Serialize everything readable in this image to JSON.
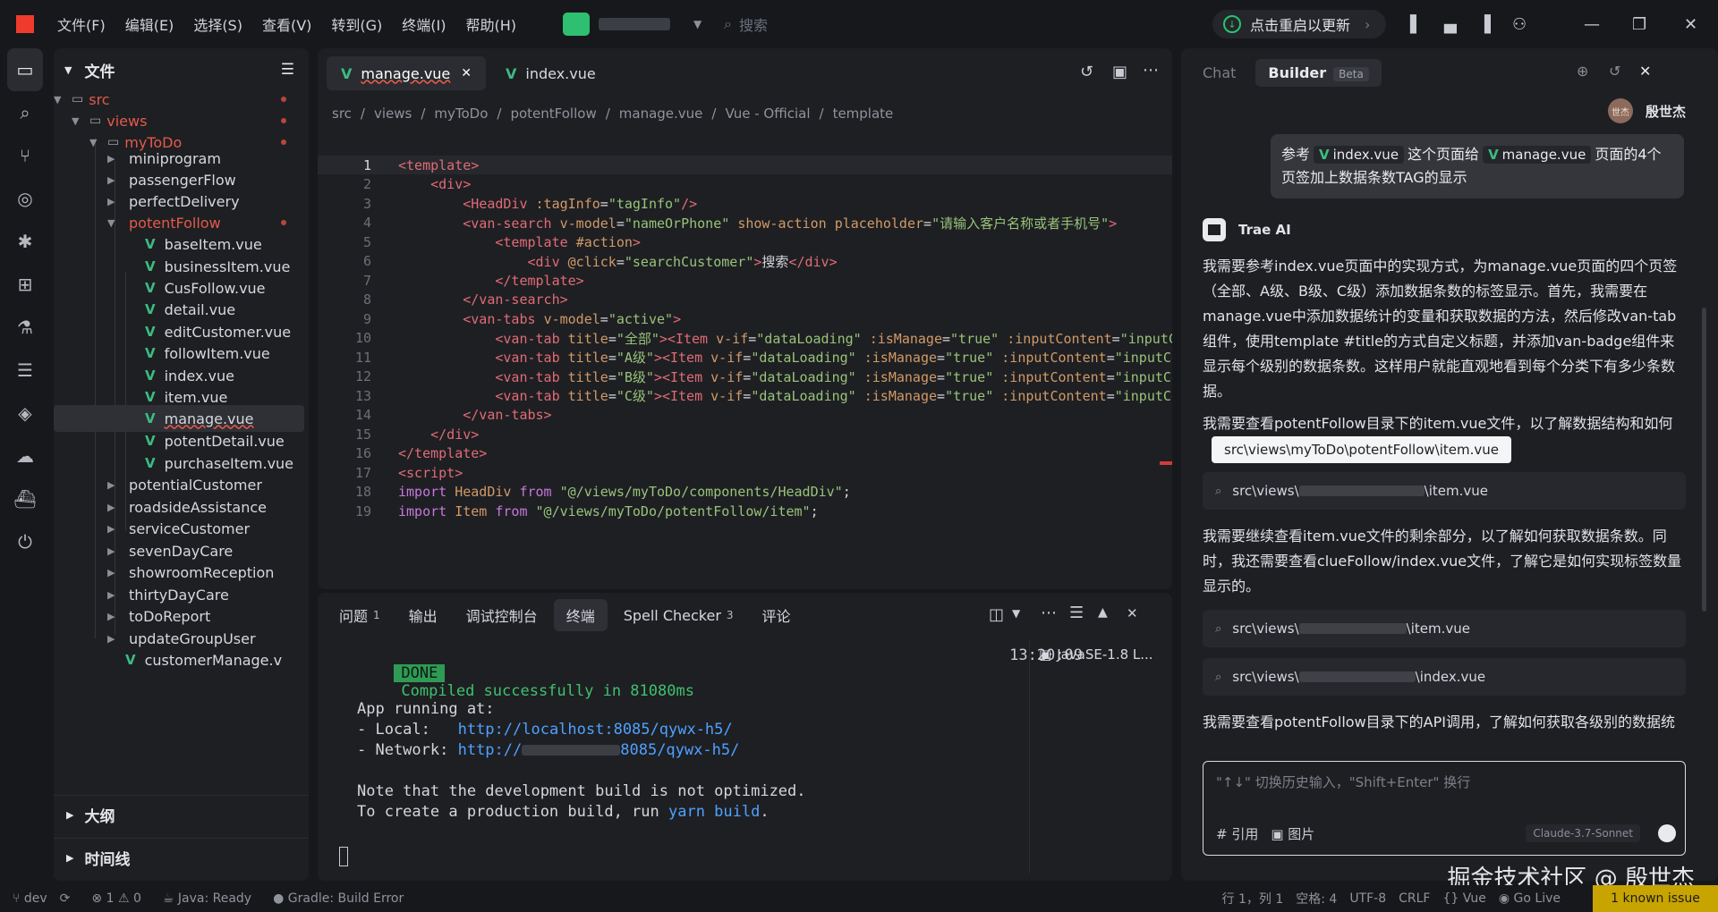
{
  "titlebar": {
    "menus": [
      "文件(F)",
      "编辑(E)",
      "选择(S)",
      "查看(V)",
      "转到(G)",
      "终端(I)",
      "帮助(H)"
    ],
    "search_placeholder": "搜索",
    "update_label": "点击重启以更新"
  },
  "sidebar": {
    "title": "文件",
    "tree": [
      {
        "label": "src",
        "type": "folder",
        "error": true
      },
      {
        "label": "views",
        "type": "folder",
        "error": true
      },
      {
        "label": "myToDo",
        "type": "folder",
        "error": true
      },
      {
        "label": "miniprogram",
        "type": "folder"
      },
      {
        "label": "passengerFlow",
        "type": "folder"
      },
      {
        "label": "perfectDelivery",
        "type": "folder"
      },
      {
        "label": "potentFollow",
        "type": "folder",
        "error": true
      },
      {
        "label": "baseItem.vue",
        "type": "vue"
      },
      {
        "label": "businessItem.vue",
        "type": "vue"
      },
      {
        "label": "CusFollow.vue",
        "type": "vue"
      },
      {
        "label": "detail.vue",
        "type": "vue"
      },
      {
        "label": "editCustomer.vue",
        "type": "vue"
      },
      {
        "label": "followItem.vue",
        "type": "vue"
      },
      {
        "label": "index.vue",
        "type": "vue"
      },
      {
        "label": "item.vue",
        "type": "vue"
      },
      {
        "label": "manage.vue",
        "type": "vue",
        "selected": true
      },
      {
        "label": "potentDetail.vue",
        "type": "vue"
      },
      {
        "label": "purchaseItem.vue",
        "type": "vue"
      },
      {
        "label": "potentialCustomer",
        "type": "folder"
      },
      {
        "label": "roadsideAssistance",
        "type": "folder"
      },
      {
        "label": "serviceCustomer",
        "type": "folder"
      },
      {
        "label": "sevenDayCare",
        "type": "folder"
      },
      {
        "label": "showroomReception",
        "type": "folder"
      },
      {
        "label": "thirtyDayCare",
        "type": "folder"
      },
      {
        "label": "toDoReport",
        "type": "folder"
      },
      {
        "label": "updateGroupUser",
        "type": "folder"
      },
      {
        "label": "customerManage.v",
        "type": "vue"
      }
    ],
    "outline_label": "大纲",
    "timeline_label": "时间线"
  },
  "editor": {
    "tabs": [
      {
        "label": "manage.vue",
        "active": true
      },
      {
        "label": "index.vue",
        "active": false
      }
    ],
    "breadcrumb": [
      "src",
      "views",
      "myToDo",
      "potentFollow",
      "manage.vue",
      "Vue - Official",
      "template"
    ],
    "lines": [
      {
        "n": "1",
        "html": "<span class='tag'>&lt;template&gt;</span>"
      },
      {
        "n": "2",
        "html": "    <span class='tag'>&lt;div&gt;</span>"
      },
      {
        "n": "3",
        "html": "        <span class='tag'>&lt;HeadDiv</span> <span class='attr'>:tagInfo</span>=<span class='str'>\"tagInfo\"</span><span class='tag'>/&gt;</span>"
      },
      {
        "n": "4",
        "html": "        <span class='tag'>&lt;van-search</span> <span class='attr'>v-model</span>=<span class='str'>\"nameOrPhone\"</span> <span class='attr'>show-action</span> <span class='attr'>placeholder</span>=<span class='str'>\"请输入客户名称或者手机号\"</span><span class='tag'>&gt;</span>"
      },
      {
        "n": "5",
        "html": "            <span class='tag'>&lt;template</span> <span class='attr'>#action</span><span class='tag'>&gt;</span>"
      },
      {
        "n": "6",
        "html": "                <span class='tag'>&lt;div</span> <span class='attr'>@click</span>=<span class='str'>\"searchCustomer\"</span><span class='tag'>&gt;</span>搜索<span class='tag'>&lt;/div&gt;</span>"
      },
      {
        "n": "7",
        "html": "            <span class='tag'>&lt;/template&gt;</span>"
      },
      {
        "n": "8",
        "html": "        <span class='tag'>&lt;/van-search&gt;</span>"
      },
      {
        "n": "9",
        "html": "        <span class='tag'>&lt;van-tabs</span> <span class='attr'>v-model</span>=<span class='str'>\"active\"</span><span class='tag'>&gt;</span>"
      },
      {
        "n": "10",
        "html": "            <span class='tag'>&lt;van-tab</span> <span class='attr'>title</span>=<span class='str'>\"全部\"</span><span class='tag'>&gt;&lt;Item</span> <span class='attr'>v-if</span>=<span class='str'>\"dataLoading\"</span> <span class='attr'>:isManage</span>=<span class='str'>\"true\"</span> <span class='attr'>:inputContent</span>=<span class='str'>\"inputC</span>"
      },
      {
        "n": "11",
        "html": "            <span class='tag'>&lt;van-tab</span> <span class='attr'>title</span>=<span class='str'>\"A级\"</span><span class='tag'>&gt;&lt;Item</span> <span class='attr'>v-if</span>=<span class='str'>\"dataLoading\"</span> <span class='attr'>:isManage</span>=<span class='str'>\"true\"</span> <span class='attr'>:inputContent</span>=<span class='str'>\"inputCo</span>"
      },
      {
        "n": "12",
        "html": "            <span class='tag'>&lt;van-tab</span> <span class='attr'>title</span>=<span class='str'>\"B级\"</span><span class='tag'>&gt;&lt;Item</span> <span class='attr'>v-if</span>=<span class='str'>\"dataLoading\"</span> <span class='attr'>:isManage</span>=<span class='str'>\"true\"</span> <span class='attr'>:inputContent</span>=<span class='str'>\"inputCo</span>"
      },
      {
        "n": "13",
        "html": "            <span class='tag'>&lt;van-tab</span> <span class='attr'>title</span>=<span class='str'>\"C级\"</span><span class='tag'>&gt;&lt;Item</span> <span class='attr'>v-if</span>=<span class='str'>\"dataLoading\"</span> <span class='attr'>:isManage</span>=<span class='str'>\"true\"</span> <span class='attr'>:inputContent</span>=<span class='str'>\"inputCo</span>"
      },
      {
        "n": "14",
        "html": "        <span class='tag'>&lt;/van-tabs&gt;</span>"
      },
      {
        "n": "15",
        "html": "    <span class='tag'>&lt;/div&gt;</span>"
      },
      {
        "n": "16",
        "html": "<span class='tag'>&lt;/template&gt;</span>"
      },
      {
        "n": "17",
        "html": "<span class='tag'>&lt;script&gt;</span>"
      },
      {
        "n": "18",
        "html": "<span class='kw'>import</span> <span class='attr'>HeadDiv</span> <span class='kw'>from</span> <span class='str'>\"@/views/myToDo/components/HeadDiv\"</span>;"
      },
      {
        "n": "19",
        "html": "<span class='kw'>import</span> <span class='attr'>Item</span> <span class='kw'>from</span> <span class='str'>\"@/views/myToDo/potentFollow/item\"</span>;"
      }
    ]
  },
  "panel": {
    "tabs": [
      {
        "label": "问题",
        "count": "1"
      },
      {
        "label": "输出",
        "count": ""
      },
      {
        "label": "调试控制台",
        "count": ""
      },
      {
        "label": "终端",
        "count": "",
        "active": true
      },
      {
        "label": "Spell Checker",
        "count": "3"
      },
      {
        "label": "评论",
        "count": ""
      }
    ],
    "done": "DONE",
    "compiled": "Compiled successfully in 81080ms",
    "time": "13:20:09",
    "app_running": "App running at:",
    "local_prefix": "- Local:   ",
    "local_url": "http://localhost:8085/qywx-h5/",
    "network_prefix": "- Network: ",
    "network_url": "http://",
    "network_url_tail": "8085/qywx-h5/",
    "note1": "Note that the development build is not optimized.",
    "note2_prefix": "To create a production build, run ",
    "note2_cmd": "yarn build",
    "note2_suffix": ".",
    "terminal_item": "JavaSE-1.8 L..."
  },
  "chat": {
    "tab_chat": "Chat",
    "tab_builder": "Builder",
    "beta": "Beta",
    "user_avatar": "世杰",
    "user_name": "殷世杰",
    "user_msg_1": "参考",
    "user_chip_1": "index.vue",
    "user_msg_2": "这个页面给",
    "user_chip_2": "manage.vue",
    "user_msg_3": "页面的4个页签加上数据条数TAG的显示",
    "ai_name": "Trae AI",
    "para1": "我需要参考index.vue页面中的实现方式，为manage.vue页面的四个页签（全部、A级、B级、C级）添加数据条数的标签显示。首先，我需要在manage.vue中添加数据统计的变量和获取数据的方法，然后修改van-tab组件，使用template #title的方式自定义标题，并添加van-badge组件来显示每个级别的数据条数。这样用户就能直观地看到每个分类下有多少条数据。",
    "para2": "我需要查看potentFollow目录下的item.vue文件，以了解数据结构和如何获",
    "tooltip": "src\\views\\myToDo\\potentFollow\\item.vue",
    "card1_prefix": "src\\views\\",
    "card1_suffix": "\\item.vue",
    "para3": "我需要继续查看item.vue文件的剩余部分，以了解如何获取数据条数。同时，我还需要查看clueFollow/index.vue文件，了解它是如何实现标签数量显示的。",
    "card2_prefix": "src\\views\\",
    "card2_suffix": "\\item.vue",
    "card3_prefix": "src\\views\\",
    "card3_suffix": "\\index.vue",
    "para4": "我需要查看potentFollow目录下的API调用，了解如何获取各级别的数据统",
    "input_placeholder": "\"↑↓\" 切换历史输入，\"Shift+Enter\" 换行",
    "quote_label": "# 引用",
    "image_label": "图片",
    "model": "Claude-3.7-Sonnet",
    "watermark": "掘金技术社区 @ 殷世杰"
  },
  "statusbar": {
    "branch": "dev",
    "errors": "1",
    "warnings": "0",
    "java": "Java: Ready",
    "gradle": "Gradle: Build Error",
    "position": "行 1，列 1",
    "spaces": "空格: 4",
    "encoding": "UTF-8",
    "eol": "CRLF",
    "lang": "Vue",
    "golive": "Go Live",
    "issue": "1 known issue"
  }
}
